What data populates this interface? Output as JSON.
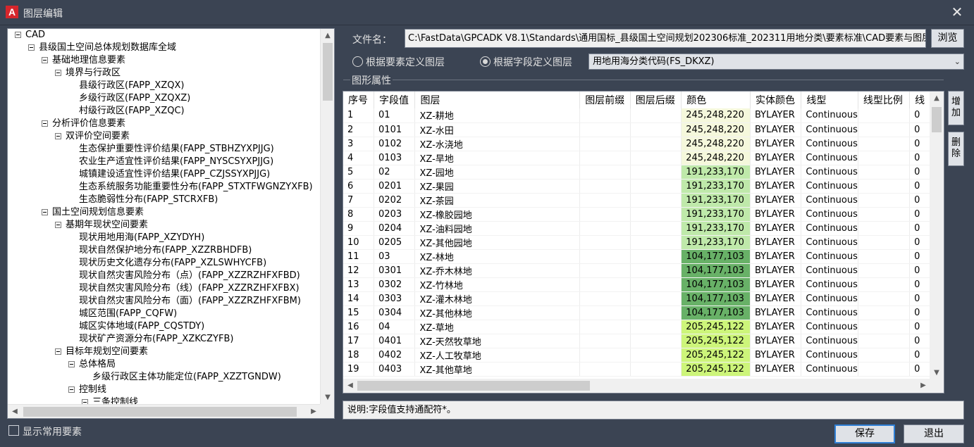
{
  "window": {
    "title": "图层编辑",
    "app_icon": "A",
    "close_glyph": "✕"
  },
  "tree": {
    "nodes": [
      {
        "label": "CAD",
        "level": 0
      },
      {
        "label": "县级国土空间总体规划数据库全域",
        "level": 1
      },
      {
        "label": "基础地理信息要素",
        "level": 2
      },
      {
        "label": "境界与行政区",
        "level": 3
      },
      {
        "label": "县级行政区(FAPP_XZQX)",
        "level": 4
      },
      {
        "label": "乡级行政区(FAPP_XZQXZ)",
        "level": 4
      },
      {
        "label": "村级行政区(FAPP_XZQC)",
        "level": 4
      },
      {
        "label": "分析评价信息要素",
        "level": 2
      },
      {
        "label": "双评价空间要素",
        "level": 3
      },
      {
        "label": "生态保护重要性评价结果(FAPP_STBHZYXPJJG)",
        "level": 4
      },
      {
        "label": "农业生产适宜性评价结果(FAPP_NYSCSYXPJJG)",
        "level": 4
      },
      {
        "label": "城镇建设适宜性评价结果(FAPP_CZJSSYXPJJG)",
        "level": 4
      },
      {
        "label": "生态系统服务功能重要性分布(FAPP_STXTFWGNZYXFB)",
        "level": 4
      },
      {
        "label": "生态脆弱性分布(FAPP_STCRXFB)",
        "level": 4
      },
      {
        "label": "国土空间规划信息要素",
        "level": 2
      },
      {
        "label": "基期年现状空间要素",
        "level": 3
      },
      {
        "label": "现状用地用海(FAPP_XZYDYH)",
        "level": 4
      },
      {
        "label": "现状自然保护地分布(FAPP_XZZRBHDFB)",
        "level": 4
      },
      {
        "label": "现状历史文化遗存分布(FAPP_XZLSWHYCFB)",
        "level": 4
      },
      {
        "label": "现状自然灾害风险分布（点）(FAPP_XZZRZHFXFBD)",
        "level": 4
      },
      {
        "label": "现状自然灾害风险分布（线）(FAPP_XZZRZHFXFBX)",
        "level": 4
      },
      {
        "label": "现状自然灾害风险分布（面）(FAPP_XZZRZHFXFBM)",
        "level": 4
      },
      {
        "label": "城区范围(FAPP_CQFW)",
        "level": 4
      },
      {
        "label": "城区实体地域(FAPP_CQSTDY)",
        "level": 4
      },
      {
        "label": "现状矿产资源分布(FAPP_XZKCZYFB)",
        "level": 4
      },
      {
        "label": "目标年规划空间要素",
        "level": 3
      },
      {
        "label": "总体格局",
        "level": 4
      },
      {
        "label": "乡级行政区主体功能定位(FAPP_XZZTGNDW)",
        "level": 5
      },
      {
        "label": "控制线",
        "level": 4
      },
      {
        "label": "三条控制线",
        "level": 5
      }
    ]
  },
  "show_common_label": "显示常用要素",
  "file": {
    "label": "文件名：",
    "path": "C:\\FastData\\GPCADK V8.1\\Standards\\通用国标_县级国土空间规划202306标准_202311用地分类\\要素标准\\CAD要素与图层",
    "browse": "浏览"
  },
  "mode": {
    "option1": "根据要素定义图层",
    "option2": "根据字段定义图层",
    "selected": 2,
    "field_select": "用地用海分类代码(FS_DKXZ)"
  },
  "group_title": "图形属性",
  "table": {
    "headers": [
      "序号",
      "字段值",
      "图层",
      "图层前缀",
      "图层后缀",
      "颜色",
      "实体颜色",
      "线型",
      "线型比例",
      "线"
    ],
    "rows": [
      {
        "idx": "1",
        "value": "01",
        "layer": "XZ-耕地",
        "color": "245,248,220",
        "hex": "#f5f8dc",
        "entity": "BYLAYER",
        "ltype": "Continuous",
        "last": "0"
      },
      {
        "idx": "2",
        "value": "0101",
        "layer": "XZ-水田",
        "color": "245,248,220",
        "hex": "#f5f8dc",
        "entity": "BYLAYER",
        "ltype": "Continuous",
        "last": "0"
      },
      {
        "idx": "3",
        "value": "0102",
        "layer": "XZ-水浇地",
        "color": "245,248,220",
        "hex": "#f5f8dc",
        "entity": "BYLAYER",
        "ltype": "Continuous",
        "last": "0"
      },
      {
        "idx": "4",
        "value": "0103",
        "layer": "XZ-旱地",
        "color": "245,248,220",
        "hex": "#f5f8dc",
        "entity": "BYLAYER",
        "ltype": "Continuous",
        "last": "0"
      },
      {
        "idx": "5",
        "value": "02",
        "layer": "XZ-园地",
        "color": "191,233,170",
        "hex": "#bfe9aa",
        "entity": "BYLAYER",
        "ltype": "Continuous",
        "last": "0"
      },
      {
        "idx": "6",
        "value": "0201",
        "layer": "XZ-果园",
        "color": "191,233,170",
        "hex": "#bfe9aa",
        "entity": "BYLAYER",
        "ltype": "Continuous",
        "last": "0"
      },
      {
        "idx": "7",
        "value": "0202",
        "layer": "XZ-茶园",
        "color": "191,233,170",
        "hex": "#bfe9aa",
        "entity": "BYLAYER",
        "ltype": "Continuous",
        "last": "0"
      },
      {
        "idx": "8",
        "value": "0203",
        "layer": "XZ-橡胶园地",
        "color": "191,233,170",
        "hex": "#bfe9aa",
        "entity": "BYLAYER",
        "ltype": "Continuous",
        "last": "0"
      },
      {
        "idx": "9",
        "value": "0204",
        "layer": "XZ-油料园地",
        "color": "191,233,170",
        "hex": "#bfe9aa",
        "entity": "BYLAYER",
        "ltype": "Continuous",
        "last": "0"
      },
      {
        "idx": "10",
        "value": "0205",
        "layer": "XZ-其他园地",
        "color": "191,233,170",
        "hex": "#bfe9aa",
        "entity": "BYLAYER",
        "ltype": "Continuous",
        "last": "0"
      },
      {
        "idx": "11",
        "value": "03",
        "layer": "XZ-林地",
        "color": "104,177,103",
        "hex": "#68b167",
        "entity": "BYLAYER",
        "ltype": "Continuous",
        "last": "0"
      },
      {
        "idx": "12",
        "value": "0301",
        "layer": "XZ-乔木林地",
        "color": "104,177,103",
        "hex": "#68b167",
        "entity": "BYLAYER",
        "ltype": "Continuous",
        "last": "0"
      },
      {
        "idx": "13",
        "value": "0302",
        "layer": "XZ-竹林地",
        "color": "104,177,103",
        "hex": "#68b167",
        "entity": "BYLAYER",
        "ltype": "Continuous",
        "last": "0"
      },
      {
        "idx": "14",
        "value": "0303",
        "layer": "XZ-灌木林地",
        "color": "104,177,103",
        "hex": "#68b167",
        "entity": "BYLAYER",
        "ltype": "Continuous",
        "last": "0"
      },
      {
        "idx": "15",
        "value": "0304",
        "layer": "XZ-其他林地",
        "color": "104,177,103",
        "hex": "#68b167",
        "entity": "BYLAYER",
        "ltype": "Continuous",
        "last": "0"
      },
      {
        "idx": "16",
        "value": "04",
        "layer": "XZ-草地",
        "color": "205,245,122",
        "hex": "#cdf57a",
        "entity": "BYLAYER",
        "ltype": "Continuous",
        "last": "0"
      },
      {
        "idx": "17",
        "value": "0401",
        "layer": "XZ-天然牧草地",
        "color": "205,245,122",
        "hex": "#cdf57a",
        "entity": "BYLAYER",
        "ltype": "Continuous",
        "last": "0"
      },
      {
        "idx": "18",
        "value": "0402",
        "layer": "XZ-人工牧草地",
        "color": "205,245,122",
        "hex": "#cdf57a",
        "entity": "BYLAYER",
        "ltype": "Continuous",
        "last": "0"
      },
      {
        "idx": "19",
        "value": "0403",
        "layer": "XZ-其他草地",
        "color": "205,245,122",
        "hex": "#cdf57a",
        "entity": "BYLAYER",
        "ltype": "Continuous",
        "last": "0"
      }
    ]
  },
  "side_buttons": {
    "add": "增加",
    "delete": "删除"
  },
  "note": "说明:字段值支持通配符*。",
  "buttons": {
    "save": "保存",
    "exit": "退出"
  }
}
